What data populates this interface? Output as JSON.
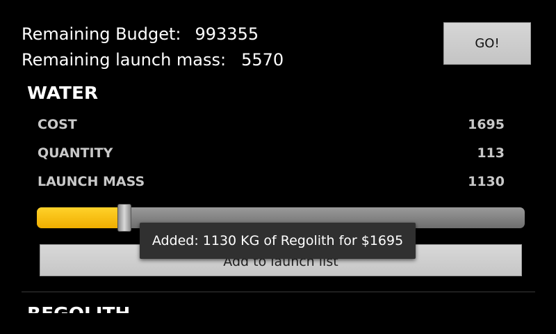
{
  "header": {
    "budget_label": "Remaining Budget:",
    "budget_value": "993355",
    "mass_label": "Remaining launch mass:",
    "mass_value": "5570",
    "go_label": "GO!"
  },
  "section": {
    "title": "WATER",
    "rows": [
      {
        "label": "COST",
        "value": "1695"
      },
      {
        "label": "QUANTITY",
        "value": "113"
      },
      {
        "label": "LAUNCH MASS",
        "value": "1130"
      }
    ],
    "slider_fraction": 0.18,
    "add_label": "Add to launch list"
  },
  "toast": {
    "message": "Added: 1130 KG of Regolith for $1695"
  },
  "next_section": {
    "title": "REGOLITH"
  },
  "colors": {
    "background": "#000000",
    "accent_fill": "#f5b800",
    "button": "#cfcfcf",
    "toast": "#303030"
  }
}
